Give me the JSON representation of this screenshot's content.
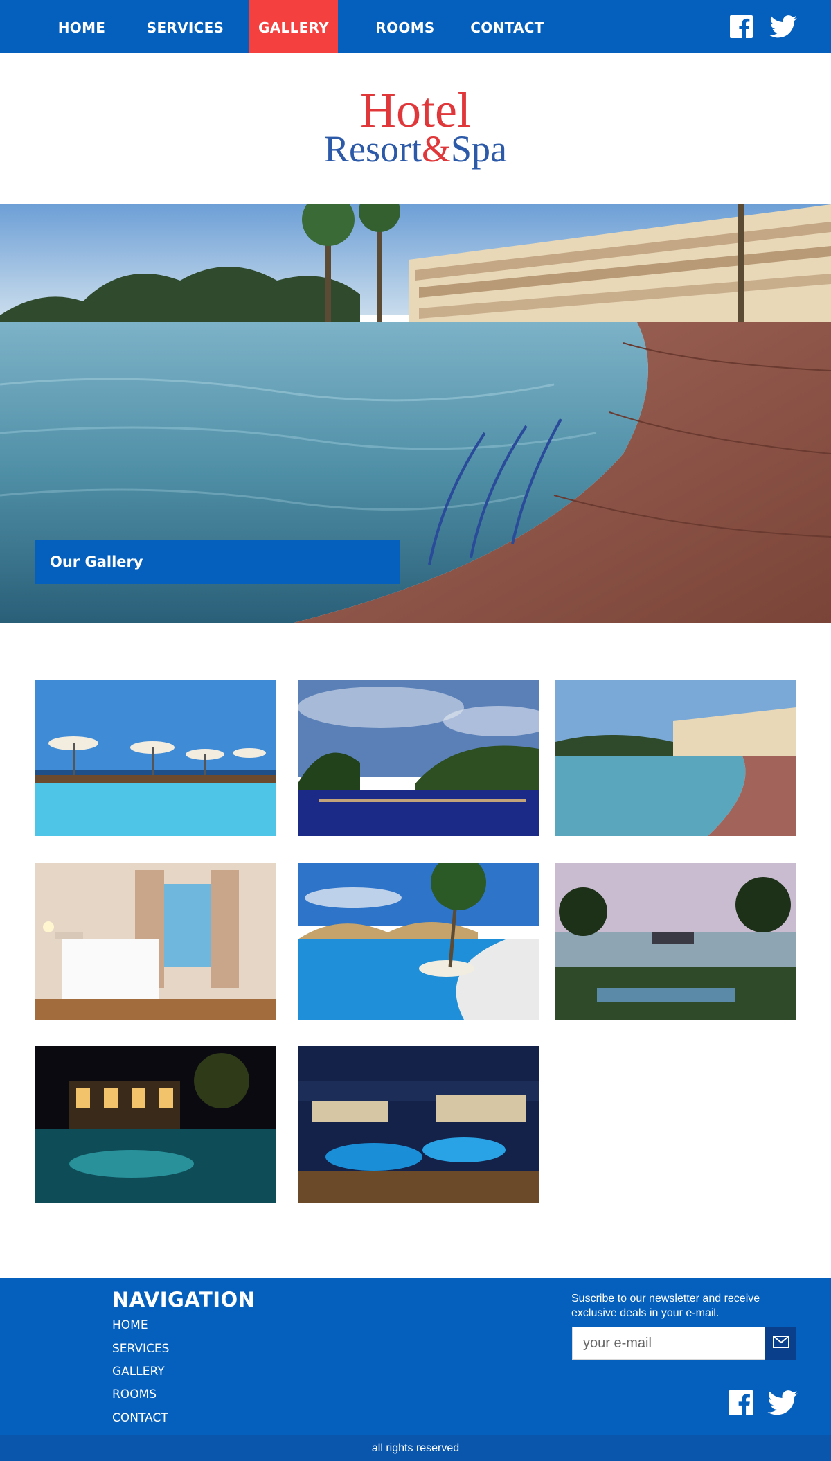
{
  "nav": {
    "items": [
      {
        "label": "HOME"
      },
      {
        "label": "SERVICES"
      },
      {
        "label": "GALLERY",
        "active": true
      },
      {
        "label": "ROOMS"
      },
      {
        "label": "CONTACT"
      }
    ],
    "social_icons": [
      "facebook-icon",
      "twitter-icon"
    ]
  },
  "logo": {
    "line1": "Hotel",
    "line2a": "Resort",
    "amp": "&",
    "line2b": "Spa"
  },
  "hero": {
    "label": "Our Gallery"
  },
  "gallery": {
    "images": [
      "poolside-umbrellas-photo",
      "tropical-pool-photo",
      "infinity-pool-photo",
      "hotel-bedroom-photo",
      "palm-pool-photo",
      "sunset-pier-photo",
      "night-pool-photo",
      "night-resort-aerial-photo"
    ]
  },
  "footer": {
    "nav_title": "NAVIGATION",
    "links": [
      "HOME",
      "SERVICES",
      "GALLERY",
      "ROOMS",
      "CONTACT"
    ],
    "newsletter_text": "Suscribe to our newsletter and receive exclusive deals in your e-mail.",
    "email_placeholder": "your e-mail",
    "copyright": "all rights reserved"
  },
  "colors": {
    "brand_blue": "#0560bd",
    "accent_red": "#f4413f",
    "dark_blue": "#0a3f8c"
  }
}
